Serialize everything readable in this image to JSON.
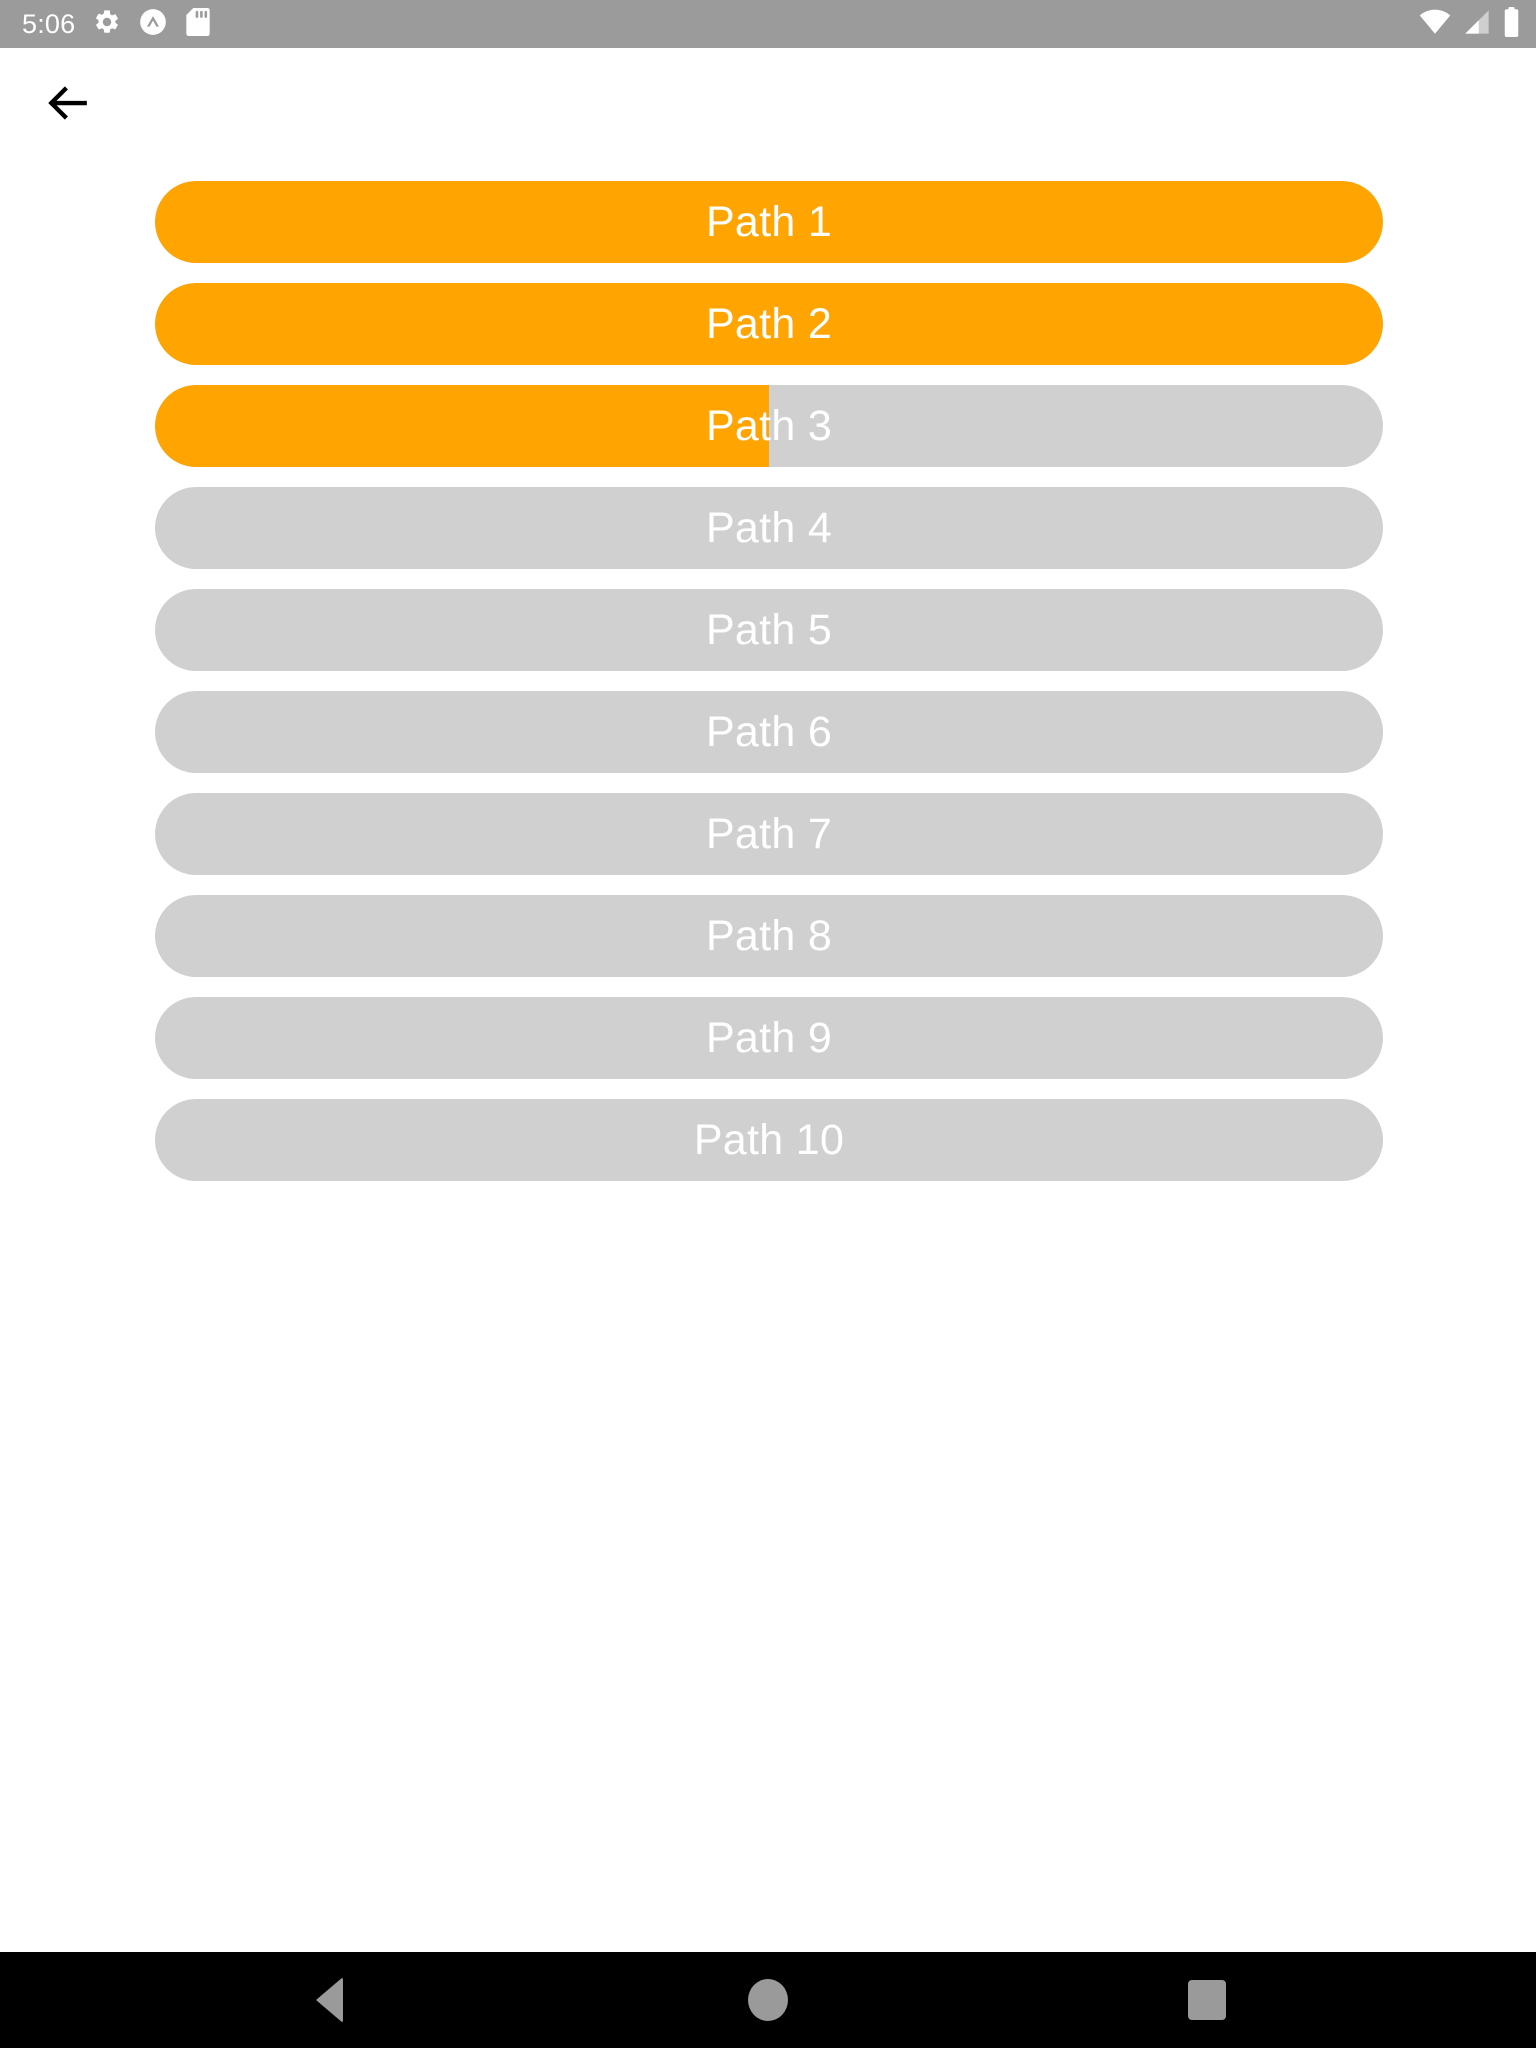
{
  "status_bar": {
    "clock": "5:06",
    "background_color": "#9b9b9b",
    "left_icons": [
      {
        "name": "settings-gear-icon",
        "glyph": "gear"
      },
      {
        "name": "caret-up-circle-icon",
        "glyph": "caret-up-circle"
      },
      {
        "name": "sd-card-icon",
        "glyph": "sd-card"
      }
    ],
    "right_icons": [
      {
        "name": "wifi-icon",
        "glyph": "wifi"
      },
      {
        "name": "cellular-signal-icon",
        "glyph": "signal"
      },
      {
        "name": "battery-icon",
        "glyph": "battery-full"
      }
    ]
  },
  "app_bar": {
    "back_label": "",
    "title": "",
    "back_icon": "arrow-back-icon"
  },
  "theme": {
    "accent_color": "#ffa400",
    "track_color": "#d0d0d0",
    "label_color": "#ffffff",
    "page_background": "#ffffff",
    "nav_bar_color": "#000000",
    "nav_icon_color": "#9a9a9a"
  },
  "main": {
    "paths": [
      {
        "label": "Path 1",
        "progress": 100
      },
      {
        "label": "Path 2",
        "progress": 100
      },
      {
        "label": "Path 3",
        "progress": 50
      },
      {
        "label": "Path 4",
        "progress": 0
      },
      {
        "label": "Path 5",
        "progress": 0
      },
      {
        "label": "Path 6",
        "progress": 0
      },
      {
        "label": "Path 7",
        "progress": 0
      },
      {
        "label": "Path 8",
        "progress": 0
      },
      {
        "label": "Path 9",
        "progress": 0
      },
      {
        "label": "Path 10",
        "progress": 0
      }
    ]
  },
  "nav_bar": {
    "buttons": [
      {
        "name": "nav-back-button",
        "label": "Back"
      },
      {
        "name": "nav-home-button",
        "label": "Home"
      },
      {
        "name": "nav-recents-button",
        "label": "Recents"
      }
    ]
  }
}
